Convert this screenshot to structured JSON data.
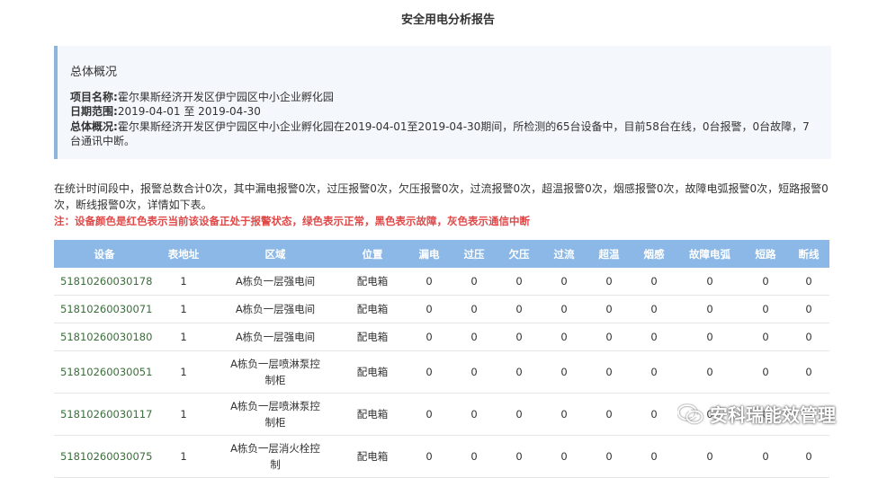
{
  "title": "安全用电分析报告",
  "overview": {
    "heading": "总体概况",
    "project_label": "项目名称:",
    "project_value": "霍尔果斯经济开发区伊宁园区中小企业孵化园",
    "date_label": "日期范围:",
    "date_value": "2019-04-01 至 2019-04-30",
    "summary_label": "总体概况:",
    "summary_value_1": "霍尔果斯经济开发区伊宁园区中小企业孵化园在2019-04-01至2019-04-30期间，所检测的65台设备中，目前58台在线，0台报警，0台故障，7",
    "summary_value_2": "台通讯中断。"
  },
  "stat_line_1": "在统计时间段中，报警总数合计0次，其中漏电报警0次，过压报警0次，欠压报警0次，过流报警0次，超温报警0次，烟感报警0次，故障电弧报警0次，短路报警0",
  "stat_line_2": "次，断线报警0次，详情如下表。",
  "note": "注：设备颜色是红色表示当前该设备正处于报警状态，绿色表示正常，黑色表示故障，灰色表示通信中断",
  "table": {
    "headers": [
      "设备",
      "表地址",
      "区域",
      "位置",
      "漏电",
      "过压",
      "欠压",
      "过流",
      "超温",
      "烟感",
      "故障电弧",
      "短路",
      "断线"
    ],
    "rows": [
      {
        "device": "51810260030178",
        "addr": "1",
        "area": "A栋负一层强电间",
        "pos": "配电箱",
        "v": [
          "0",
          "0",
          "0",
          "0",
          "0",
          "0",
          "0",
          "0",
          "0"
        ]
      },
      {
        "device": "51810260030071",
        "addr": "1",
        "area": "A栋负一层强电间",
        "pos": "配电箱",
        "v": [
          "0",
          "0",
          "0",
          "0",
          "0",
          "0",
          "0",
          "0",
          "0"
        ]
      },
      {
        "device": "51810260030180",
        "addr": "1",
        "area": "A栋负一层强电间",
        "pos": "配电箱",
        "v": [
          "0",
          "0",
          "0",
          "0",
          "0",
          "0",
          "0",
          "0",
          "0"
        ]
      },
      {
        "device": "51810260030051",
        "addr": "1",
        "area": "A栋负一层喷淋泵控制柜",
        "pos": "配电箱",
        "v": [
          "0",
          "0",
          "0",
          "0",
          "0",
          "0",
          "0",
          "0",
          "0"
        ]
      },
      {
        "device": "51810260030117",
        "addr": "1",
        "area": "A栋负一层喷淋泵控制柜",
        "pos": "配电箱",
        "v": [
          "0",
          "0",
          "0",
          "0",
          "0",
          "0",
          "0",
          "0",
          "0"
        ]
      },
      {
        "device": "51810260030075",
        "addr": "1",
        "area": "A栋负一层消火栓控制",
        "pos": "配电箱",
        "v": [
          "0",
          "0",
          "0",
          "0",
          "0",
          "0",
          "0",
          "0",
          "0"
        ]
      }
    ]
  },
  "watermark": {
    "text": "安科瑞能效管理",
    "icon": "wechat-icon"
  }
}
